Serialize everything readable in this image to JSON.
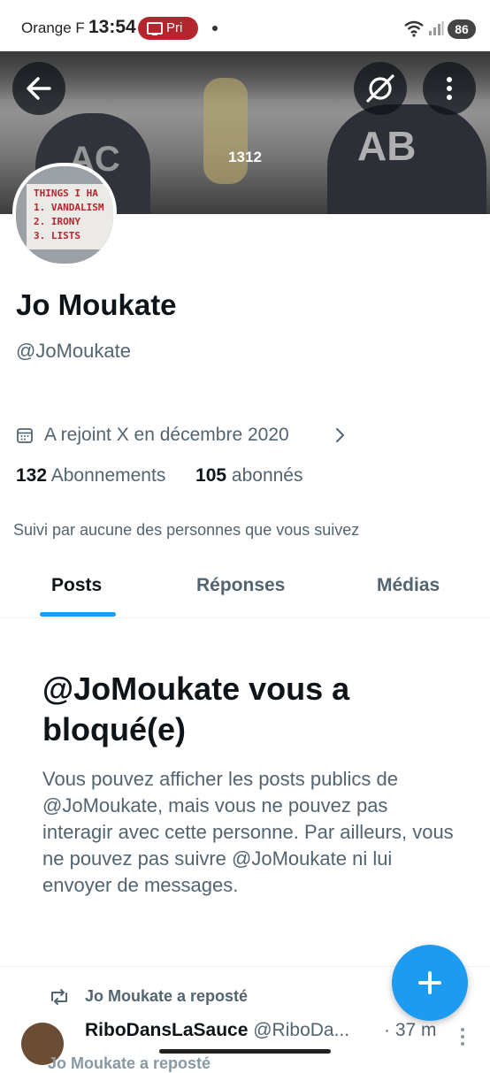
{
  "status_bar": {
    "carrier": "Orange F",
    "time": "13:54",
    "recording_label": "Pri",
    "battery": "86"
  },
  "banner": {
    "text": "1312",
    "sign_text_left": "AC",
    "sign_text_right": "AB"
  },
  "avatar": {
    "lines": [
      "THINGS I HA",
      "1. VANDALISM",
      "2. IRONY",
      "3. LISTS"
    ]
  },
  "profile": {
    "name": "Jo Moukate",
    "handle": "@JoMoukate",
    "joined": "A rejoint X en décembre 2020",
    "following_count": "132",
    "following_label": "Abonnements",
    "followers_count": "105",
    "followers_label": "abonnés",
    "followed_by": "Suivi par aucune des personnes que vous suivez"
  },
  "tabs": [
    {
      "label": "Posts",
      "active": true
    },
    {
      "label": "Réponses",
      "active": false
    },
    {
      "label": "Médias",
      "active": false
    }
  ],
  "blocked": {
    "title": "@JoMoukate vous a bloqué(e)",
    "text": "Vous pouvez afficher les posts publics de @JoMoukate, mais vous ne pouvez pas interagir avec cette personne. Par ailleurs, vous ne pouvez pas suivre @JoMoukate ni lui envoyer de messages."
  },
  "post": {
    "repost_label": "Jo Moukate a reposté",
    "author_name": "RiboDansLaSauce",
    "author_handle": "@RiboDa...",
    "time": "· 37 m",
    "next_repost_label": "Jo Moukate a reposté"
  },
  "colors": {
    "accent": "#1d9bf0",
    "text_primary": "#0f1419",
    "text_secondary": "#536471",
    "recording_badge": "#b3262e"
  }
}
